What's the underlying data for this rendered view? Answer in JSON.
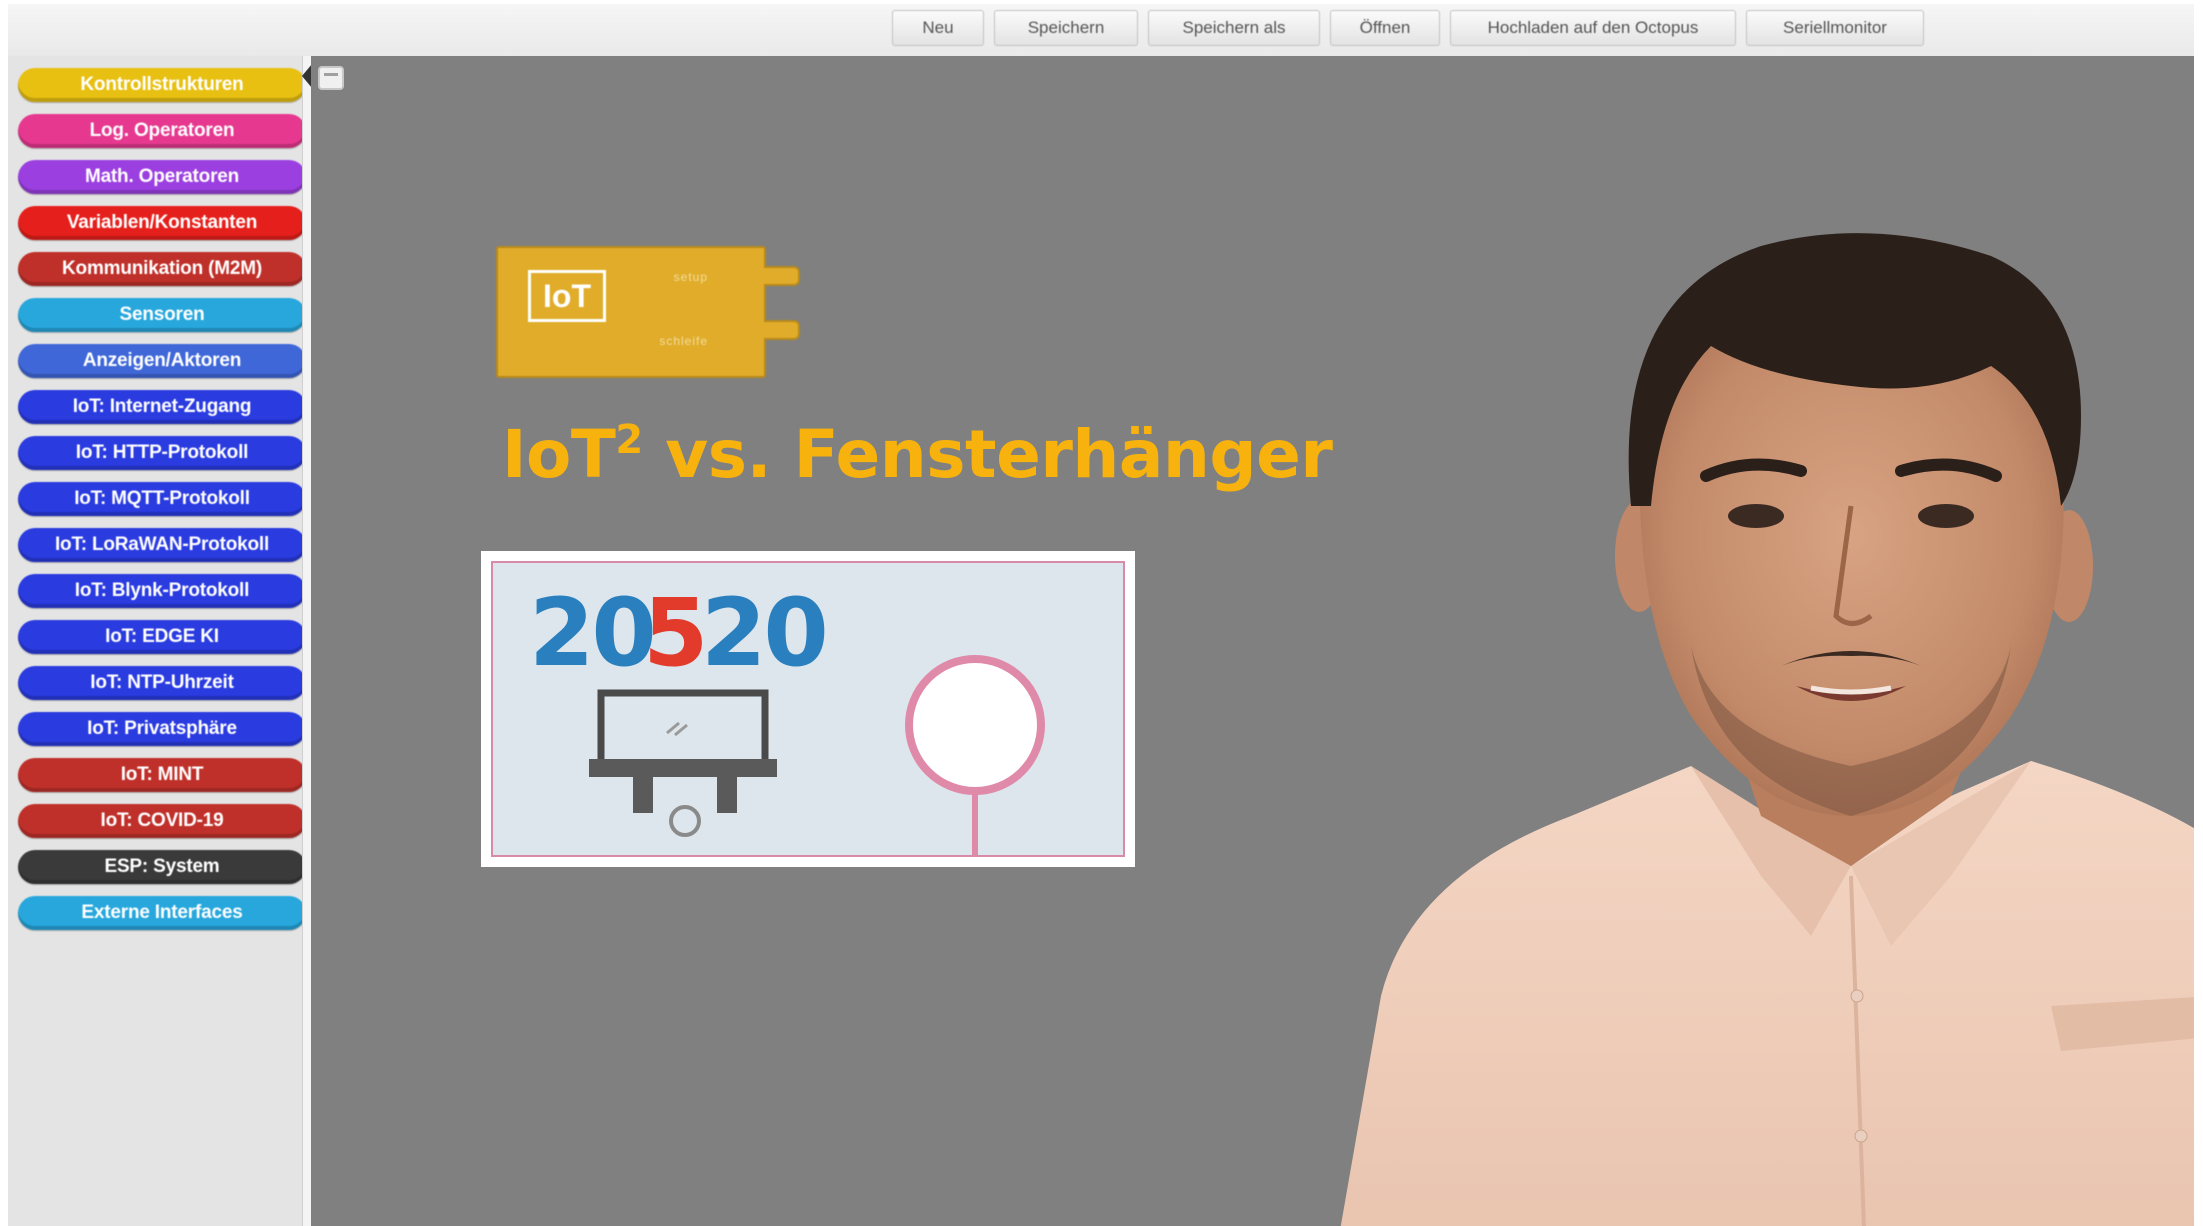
{
  "toolbar": {
    "buttons": [
      {
        "label": "Neu"
      },
      {
        "label": "Speichern"
      },
      {
        "label": "Speichern als"
      },
      {
        "label": "Öffnen"
      },
      {
        "label": "Hochladen auf den Octopus"
      },
      {
        "label": "Seriellmonitor"
      }
    ]
  },
  "sidebar": {
    "categories": [
      {
        "label": "Kontrollstrukturen",
        "color": "#e8c012"
      },
      {
        "label": "Log. Operatoren",
        "color": "#e6388f"
      },
      {
        "label": "Math. Operatoren",
        "color": "#9c3fe0"
      },
      {
        "label": "Variablen/Konstanten",
        "color": "#e5201c"
      },
      {
        "label": "Kommunikation (M2M)",
        "color": "#c0302a"
      },
      {
        "label": "Sensoren",
        "color": "#27a7dc"
      },
      {
        "label": "Anzeigen/Aktoren",
        "color": "#3f67d8"
      },
      {
        "label": "IoT: Internet-Zugang",
        "color": "#2a3be0"
      },
      {
        "label": "IoT: HTTP-Protokoll",
        "color": "#2a3be0"
      },
      {
        "label": "IoT: MQTT-Protokoll",
        "color": "#2a3be0"
      },
      {
        "label": "IoT: LoRaWAN-Protokoll",
        "color": "#2a3be0"
      },
      {
        "label": "IoT: Blynk-Protokoll",
        "color": "#2a3be0"
      },
      {
        "label": "IoT: EDGE KI",
        "color": "#2a3be0"
      },
      {
        "label": "IoT: NTP-Uhrzeit",
        "color": "#2a3be0"
      },
      {
        "label": "IoT: Privatsphäre",
        "color": "#2a3be0"
      },
      {
        "label": "IoT: MINT",
        "color": "#c0302a"
      },
      {
        "label": "IoT: COVID-19",
        "color": "#c0302a"
      },
      {
        "label": "ESP: System",
        "color": "#3a3a3a"
      },
      {
        "label": "Externe Interfaces",
        "color": "#27a7dc"
      }
    ]
  },
  "workspace": {
    "iot_block": {
      "logo": "IoT",
      "field_top": "setup",
      "field_bottom": "schleife"
    },
    "headline": {
      "main": "IoT",
      "sup": "2",
      "rest": " vs. Fensterhänger"
    },
    "card": {
      "num_a": "20",
      "num_b": "5",
      "num_c": "20",
      "color_blue": "#2a7fbf",
      "color_red": "#e23a2b"
    }
  },
  "colors": {
    "workspace_bg": "#808080",
    "headline": "#f7b20e"
  }
}
